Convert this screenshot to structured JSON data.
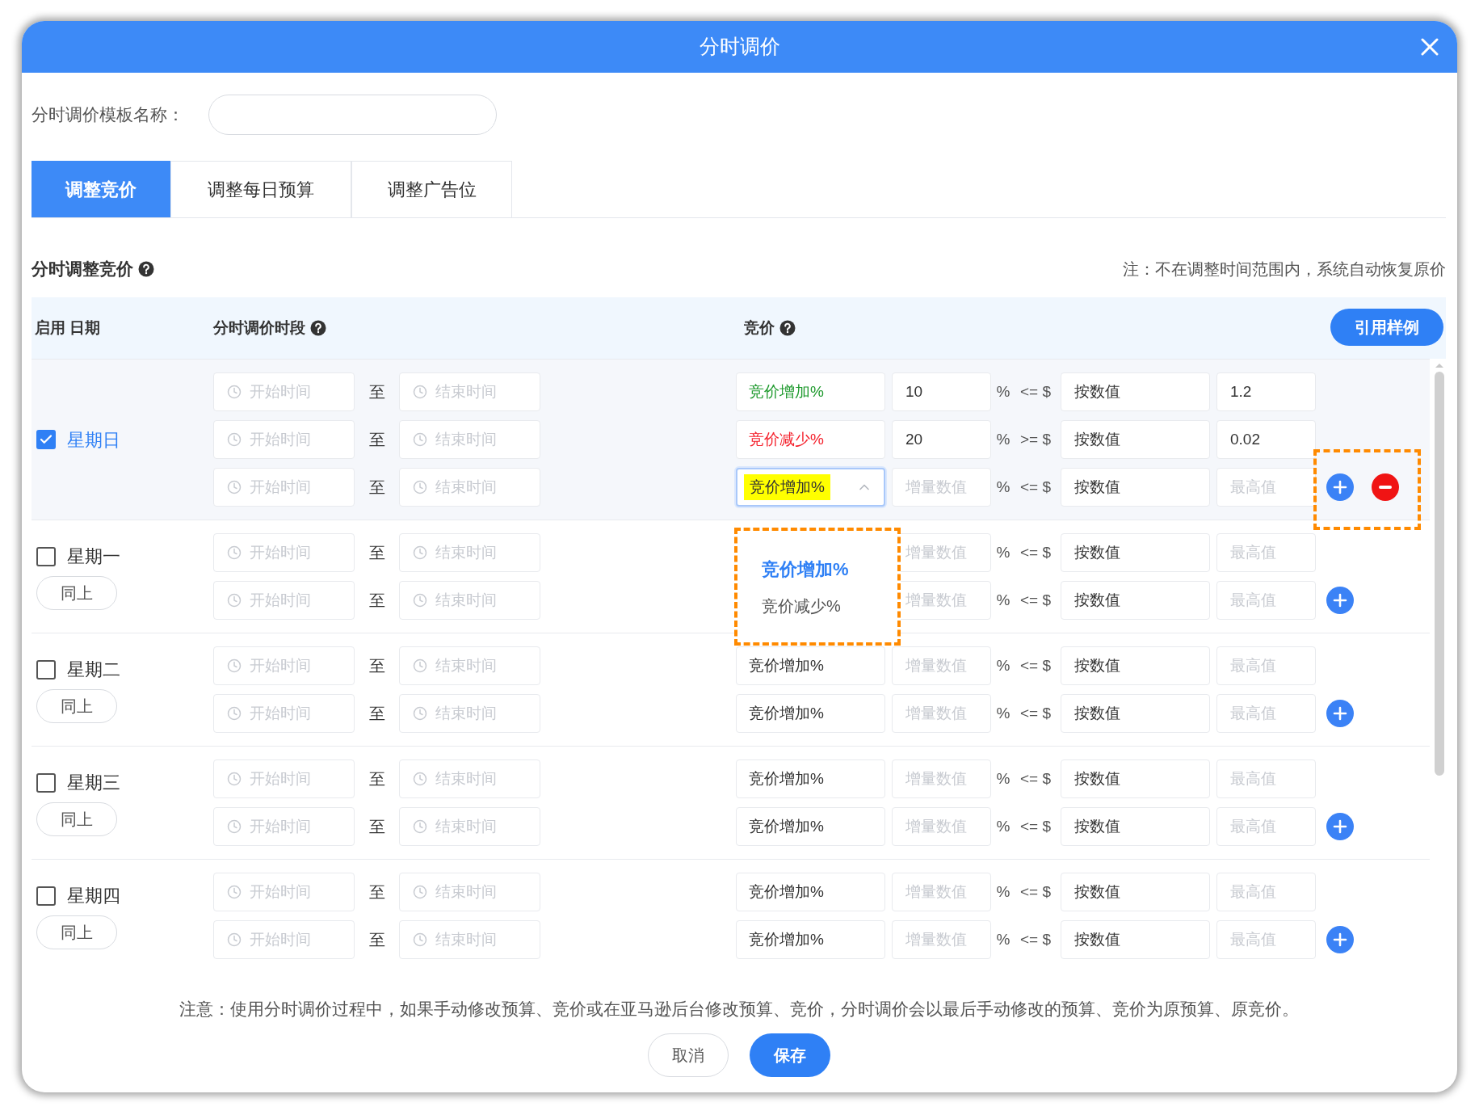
{
  "dialog": {
    "title": "分时调价"
  },
  "template_name": {
    "label": "分时调价模板名称："
  },
  "tabs": [
    {
      "label": "调整竞价",
      "selected": true
    },
    {
      "label": "调整每日预算",
      "selected": false
    },
    {
      "label": "调整广告位",
      "selected": false
    }
  ],
  "section": {
    "title": "分时调整竞价",
    "note": "注：不在调整时间范围内，系统自动恢复原价"
  },
  "table": {
    "columns": [
      {
        "label": "启用 日期",
        "help": false
      },
      {
        "label": "分时调价时段",
        "help": true
      },
      {
        "label": "竞价",
        "help": true
      }
    ],
    "sample_button": "引用样例",
    "days": [
      {
        "day": "星期日",
        "checked": true,
        "actions_framed": true,
        "actions": [
          {
            "kind": "add"
          },
          {
            "kind": "remove"
          }
        ],
        "rows": [
          {
            "start": "开始时间",
            "to": "至",
            "end": "结束时间",
            "bid_type": {
              "value": "竞价增加%",
              "color": "#1f9a2e"
            },
            "amount": {
              "value": "10"
            },
            "percent": "%",
            "operator": "<= $",
            "basis": "按数值",
            "limit": {
              "value": "1.2"
            }
          },
          {
            "start": "开始时间",
            "to": "至",
            "end": "结束时间",
            "bid_type": {
              "value": "竞价减少%",
              "color": "#f5222d"
            },
            "amount": {
              "value": "20"
            },
            "percent": "%",
            "operator": ">= $",
            "basis": "按数值",
            "limit": {
              "value": "0.02"
            }
          },
          {
            "start": "开始时间",
            "to": "至",
            "end": "结束时间",
            "bid_type": {
              "value": "竞价增加%",
              "open": true,
              "highlighted": true
            },
            "amount": {
              "placeholder": "增量数值"
            },
            "percent": "%",
            "operator": "<= $",
            "basis": "按数值",
            "limit": {
              "placeholder": "最高值"
            }
          }
        ]
      },
      {
        "day": "星期一",
        "checked": false,
        "copy_button": "同上",
        "actions_framed": false,
        "actions": [
          {
            "kind": "add"
          }
        ],
        "rows": [
          {
            "start": "开始时间",
            "to": "至",
            "end": "结束时间",
            "amount": {
              "placeholder": "增量数值"
            },
            "percent": "%",
            "operator": "<= $",
            "basis": "按数值",
            "limit": {
              "placeholder": "最高值"
            }
          },
          {
            "start": "开始时间",
            "to": "至",
            "end": "结束时间",
            "amount": {
              "placeholder": "增量数值"
            },
            "percent": "%",
            "operator": "<= $",
            "basis": "按数值",
            "limit": {
              "placeholder": "最高值"
            }
          }
        ]
      },
      {
        "day": "星期二",
        "checked": false,
        "copy_button": "同上",
        "actions_framed": false,
        "actions": [
          {
            "kind": "add"
          }
        ],
        "rows": [
          {
            "start": "开始时间",
            "to": "至",
            "end": "结束时间",
            "bid_type": {
              "value": "竞价增加%"
            },
            "amount": {
              "placeholder": "增量数值"
            },
            "percent": "%",
            "operator": "<= $",
            "basis": "按数值",
            "limit": {
              "placeholder": "最高值"
            }
          },
          {
            "start": "开始时间",
            "to": "至",
            "end": "结束时间",
            "bid_type": {
              "value": "竞价增加%"
            },
            "amount": {
              "placeholder": "增量数值"
            },
            "percent": "%",
            "operator": "<= $",
            "basis": "按数值",
            "limit": {
              "placeholder": "最高值"
            }
          }
        ]
      },
      {
        "day": "星期三",
        "checked": false,
        "copy_button": "同上",
        "actions_framed": false,
        "actions": [
          {
            "kind": "add"
          }
        ],
        "rows": [
          {
            "start": "开始时间",
            "to": "至",
            "end": "结束时间",
            "bid_type": {
              "value": "竞价增加%"
            },
            "amount": {
              "placeholder": "增量数值"
            },
            "percent": "%",
            "operator": "<= $",
            "basis": "按数值",
            "limit": {
              "placeholder": "最高值"
            }
          },
          {
            "start": "开始时间",
            "to": "至",
            "end": "结束时间",
            "bid_type": {
              "value": "竞价增加%"
            },
            "amount": {
              "placeholder": "增量数值"
            },
            "percent": "%",
            "operator": "<= $",
            "basis": "按数值",
            "limit": {
              "placeholder": "最高值"
            }
          }
        ]
      },
      {
        "day": "星期四",
        "checked": false,
        "copy_button": "同上",
        "actions_framed": false,
        "actions": [
          {
            "kind": "add"
          }
        ],
        "rows": [
          {
            "start": "开始时间",
            "to": "至",
            "end": "结束时间",
            "bid_type": {
              "value": "竞价增加%"
            },
            "amount": {
              "placeholder": "增量数值"
            },
            "percent": "%",
            "operator": "<= $",
            "basis": "按数值",
            "limit": {
              "placeholder": "最高值"
            }
          },
          {
            "start": "开始时间",
            "to": "至",
            "end": "结束时间",
            "bid_type": {
              "value": "竞价增加%"
            },
            "amount": {
              "placeholder": "增量数值"
            },
            "percent": "%",
            "operator": "<= $",
            "basis": "按数值",
            "limit": {
              "placeholder": "最高值"
            }
          }
        ]
      }
    ]
  },
  "dropdown": {
    "options": [
      {
        "label": "竞价增加%",
        "selected": true
      },
      {
        "label": "竞价减少%",
        "selected": false
      }
    ]
  },
  "footer": {
    "note": "注意：使用分时调价过程中，如果手动修改预算、竞价或在亚马逊后台修改预算、竞价，分时调价会以最后手动修改的预算、竞价为原预算、原竞价。",
    "buttons": [
      {
        "label": "取消",
        "kind": "secondary"
      },
      {
        "label": "保存",
        "kind": "primary"
      }
    ]
  }
}
